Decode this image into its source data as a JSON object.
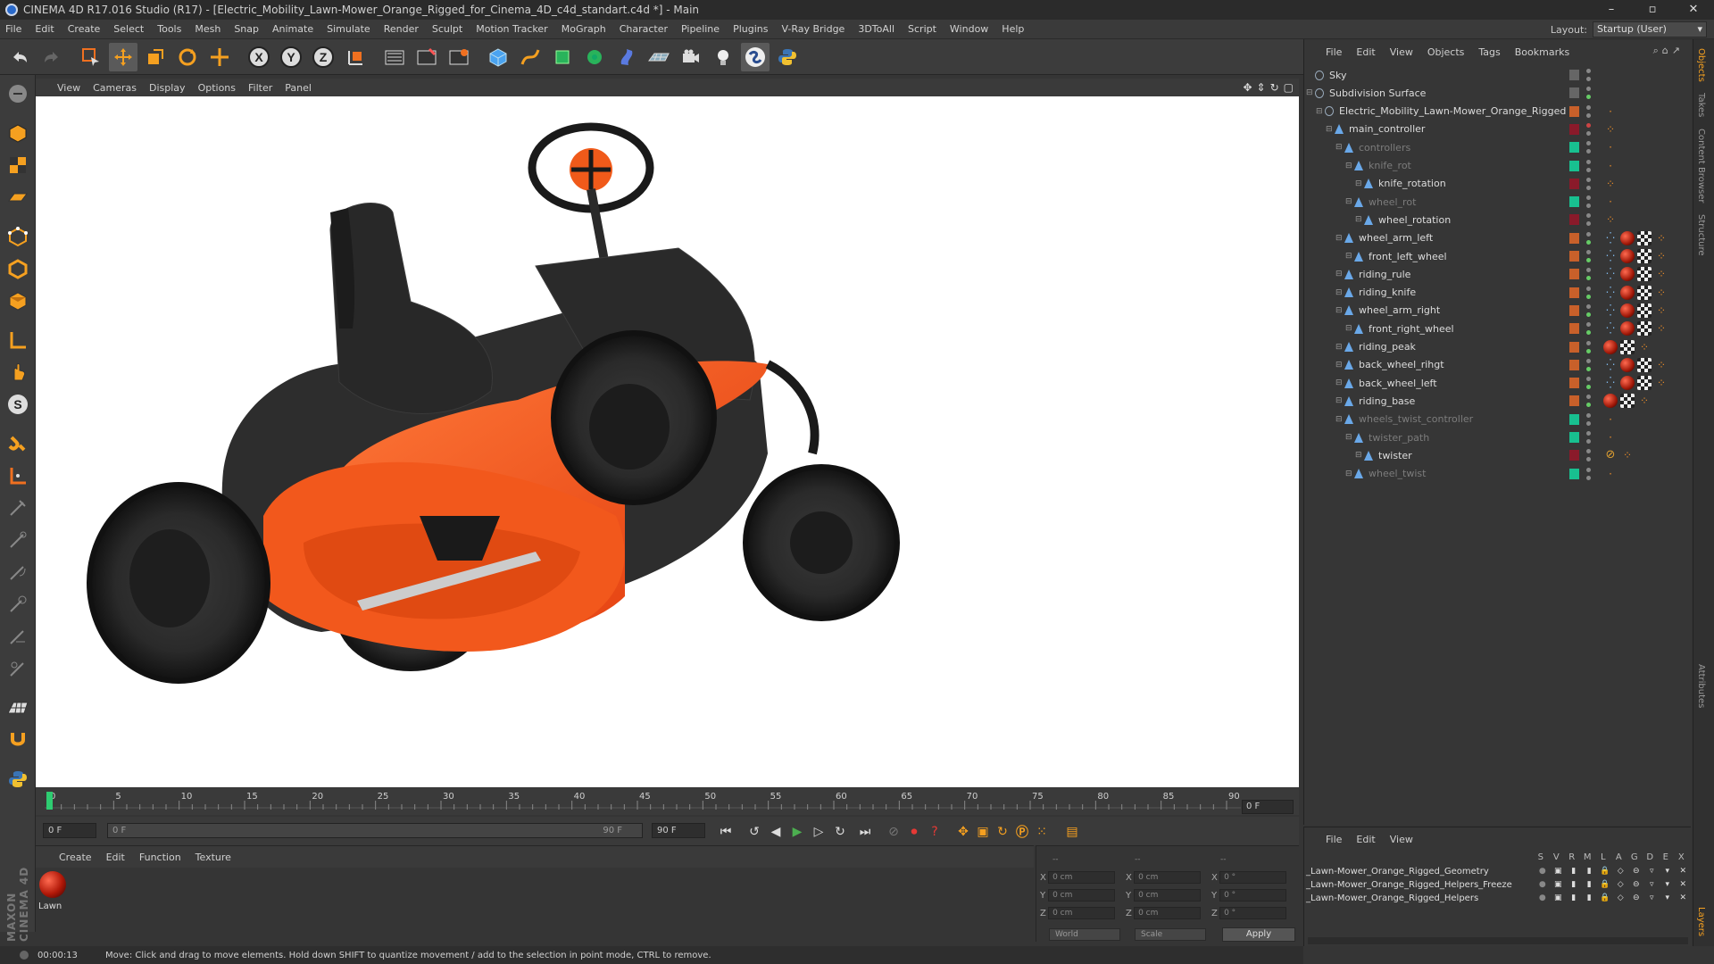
{
  "window": {
    "title": "CINEMA 4D R17.016 Studio (R17) - [Electric_Mobility_Lawn-Mower_Orange_Rigged_for_Cinema_4D_c4d_standart.c4d *] - Main"
  },
  "menu": [
    "File",
    "Edit",
    "Create",
    "Select",
    "Tools",
    "Mesh",
    "Snap",
    "Animate",
    "Simulate",
    "Render",
    "Sculpt",
    "Motion Tracker",
    "MoGraph",
    "Character",
    "Pipeline",
    "Plugins",
    "V-Ray Bridge",
    "3DToAll",
    "Script",
    "Window",
    "Help"
  ],
  "layout": {
    "label": "Layout:",
    "value": "Startup (User)"
  },
  "toolbar": {
    "axis_x": "X",
    "axis_y": "Y",
    "axis_z": "Z"
  },
  "viewport": {
    "menu": [
      "View",
      "Cameras",
      "Display",
      "Options",
      "Filter",
      "Panel"
    ]
  },
  "timeline": {
    "ticks": [
      "0",
      "5",
      "10",
      "15",
      "20",
      "25",
      "30",
      "35",
      "40",
      "45",
      "50",
      "55",
      "60",
      "65",
      "70",
      "75",
      "80",
      "85",
      "90"
    ],
    "current_frame": "0 F",
    "start_field": "0 F",
    "range_start": "0 F",
    "range_end": "90 F",
    "end_field": "90 F"
  },
  "material_manager": {
    "menu": [
      "Create",
      "Edit",
      "Function",
      "Texture"
    ],
    "material_name": "Lawn"
  },
  "coordinates": {
    "header": [
      "--",
      "--",
      "--"
    ],
    "rows": [
      {
        "axis": "X",
        "pos": "0 cm",
        "size_axis": "X",
        "size": "0 cm",
        "rot_axis": "X",
        "rot": "0 °"
      },
      {
        "axis": "Y",
        "pos": "0 cm",
        "size_axis": "Y",
        "size": "0 cm",
        "rot_axis": "Y",
        "rot": "0 °"
      },
      {
        "axis": "Z",
        "pos": "0 cm",
        "size_axis": "Z",
        "size": "0 cm",
        "rot_axis": "Z",
        "rot": "0 °"
      }
    ],
    "mode_world": "World",
    "mode_scale": "Scale",
    "apply": "Apply"
  },
  "status": {
    "time": "00:00:13",
    "message": "Move: Click and drag to move elements. Hold down SHIFT to quantize movement / add to the selection in point mode, CTRL to remove."
  },
  "object_manager": {
    "menu": [
      "File",
      "Edit",
      "View",
      "Objects",
      "Tags",
      "Bookmarks"
    ],
    "objects": [
      {
        "name": "Sky",
        "indent": 0,
        "dim": false,
        "layer": "none",
        "vis": [
          "#888",
          "#888"
        ]
      },
      {
        "name": "Subdivision Surface",
        "indent": 0,
        "dim": false,
        "layer": "none",
        "vis": [
          "#888",
          "#6c6"
        ]
      },
      {
        "name": "Electric_Mobility_Lawn-Mower_Orange_Rigged",
        "indent": 1,
        "dim": false,
        "layer": "#c8602a",
        "vis": [
          "#888",
          "#888"
        ]
      },
      {
        "name": "main_controller",
        "indent": 2,
        "dim": false,
        "layer": "#8a1a2a",
        "vis": [
          "#c44",
          "#888"
        ]
      },
      {
        "name": "controllers",
        "indent": 3,
        "dim": true,
        "layer": "#18c090",
        "vis": [
          "#888",
          "#888"
        ]
      },
      {
        "name": "knife_rot",
        "indent": 4,
        "dim": true,
        "layer": "#18c090",
        "vis": [
          "#888",
          "#888"
        ]
      },
      {
        "name": "knife_rotation",
        "indent": 5,
        "dim": false,
        "layer": "#8a1a2a",
        "vis": [
          "#888",
          "#888"
        ]
      },
      {
        "name": "wheel_rot",
        "indent": 4,
        "dim": true,
        "layer": "#18c090",
        "vis": [
          "#888",
          "#888"
        ]
      },
      {
        "name": "wheel_rotation",
        "indent": 5,
        "dim": false,
        "layer": "#8a1a2a",
        "vis": [
          "#888",
          "#888"
        ]
      },
      {
        "name": "wheel_arm_left",
        "indent": 3,
        "dim": false,
        "layer": "#c8602a",
        "vis": [
          "#888",
          "#6c6"
        ]
      },
      {
        "name": "front_left_wheel",
        "indent": 4,
        "dim": false,
        "layer": "#c8602a",
        "vis": [
          "#888",
          "#6c6"
        ]
      },
      {
        "name": "riding_rule",
        "indent": 3,
        "dim": false,
        "layer": "#c8602a",
        "vis": [
          "#888",
          "#6c6"
        ]
      },
      {
        "name": "riding_knife",
        "indent": 3,
        "dim": false,
        "layer": "#c8602a",
        "vis": [
          "#888",
          "#6c6"
        ]
      },
      {
        "name": "wheel_arm_right",
        "indent": 3,
        "dim": false,
        "layer": "#c8602a",
        "vis": [
          "#888",
          "#6c6"
        ]
      },
      {
        "name": "front_right_wheel",
        "indent": 4,
        "dim": false,
        "layer": "#c8602a",
        "vis": [
          "#888",
          "#6c6"
        ]
      },
      {
        "name": "riding_peak",
        "indent": 3,
        "dim": false,
        "layer": "#c8602a",
        "vis": [
          "#888",
          "#6c6"
        ]
      },
      {
        "name": "back_wheel_rihgt",
        "indent": 3,
        "dim": false,
        "layer": "#c8602a",
        "vis": [
          "#888",
          "#6c6"
        ]
      },
      {
        "name": "back_wheel_left",
        "indent": 3,
        "dim": false,
        "layer": "#c8602a",
        "vis": [
          "#888",
          "#6c6"
        ]
      },
      {
        "name": "riding_base",
        "indent": 3,
        "dim": false,
        "layer": "#c8602a",
        "vis": [
          "#888",
          "#6c6"
        ]
      },
      {
        "name": "wheels_twist_controller",
        "indent": 3,
        "dim": true,
        "layer": "#18c090",
        "vis": [
          "#888",
          "#888"
        ]
      },
      {
        "name": "twister_path",
        "indent": 4,
        "dim": true,
        "layer": "#18c090",
        "vis": [
          "#888",
          "#888"
        ]
      },
      {
        "name": "twister",
        "indent": 5,
        "dim": false,
        "layer": "#8a1a2a",
        "vis": [
          "#888",
          "#888"
        ]
      },
      {
        "name": "wheel_twist",
        "indent": 4,
        "dim": true,
        "layer": "#18c090",
        "vis": [
          "#888",
          "#888"
        ]
      }
    ]
  },
  "layer_manager": {
    "menu": [
      "File",
      "Edit",
      "View"
    ],
    "columns": [
      "S",
      "V",
      "R",
      "M",
      "L",
      "A",
      "G",
      "D",
      "E",
      "X"
    ],
    "layers": [
      {
        "name": "_Lawn-Mower_Orange_Rigged_Geometry",
        "color": "#888888"
      },
      {
        "name": "_Lawn-Mower_Orange_Rigged_Helpers_Freeze",
        "color": "#888888"
      },
      {
        "name": "_Lawn-Mower_Orange_Rigged_Helpers",
        "color": "#888888"
      }
    ]
  },
  "side_tabs": [
    "Objects",
    "Takes",
    "Content Browser",
    "Structure",
    "Attributes",
    "Layers"
  ],
  "brand": "MAXON CINEMA 4D"
}
